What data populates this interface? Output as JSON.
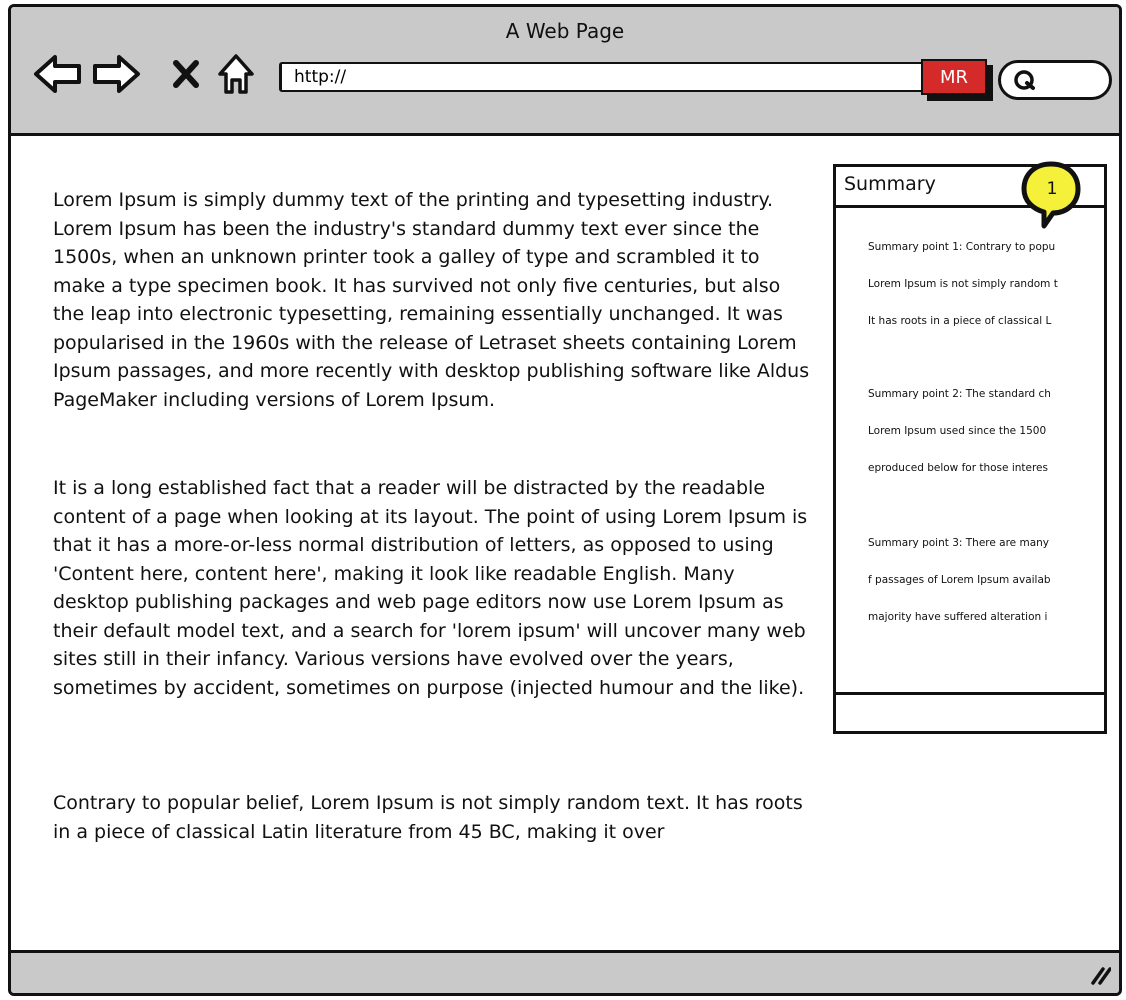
{
  "window": {
    "title": "A Web Page"
  },
  "toolbar": {
    "back_icon": "back-arrow-icon",
    "forward_icon": "forward-arrow-icon",
    "stop_icon": "close-x-icon",
    "home_icon": "home-icon",
    "address_value": "http://",
    "mr_label": "MR",
    "search_icon": "search-icon",
    "mr_color": "#d42a2a",
    "chrome_color": "#c9c9c9"
  },
  "article": {
    "paragraph1": "Lorem Ipsum is simply dummy text of the printing and typesetting industry. Lorem Ipsum has been the industry's standard dummy text ever since the 1500s, when an unknown printer took a galley of type and scrambled it to make a type specimen book. It has survived not only five centuries, but also the leap into electronic typesetting, remaining essentially unchanged. It was popularised in the 1960s with the release of Letraset sheets containing Lorem Ipsum passages, and more recently with desktop publishing software like Aldus PageMaker including versions of Lorem Ipsum.",
    "paragraph2": "It is a long established fact that a reader will be distracted by the readable content of a page when looking at its layout. The point of using Lorem Ipsum is that it has a more-or-less normal distribution of letters, as opposed to using 'Content here, content here', making it look like readable English. Many desktop publishing packages and web page editors now use Lorem Ipsum as their default model text, and a search for 'lorem ipsum' will uncover many web sites still in their infancy. Various versions have evolved over the years, sometimes by accident, sometimes on purpose (injected humour and the like).",
    "paragraph3": "Contrary to popular belief, Lorem Ipsum is not simply random text. It has roots in a piece of classical Latin literature from 45 BC, making it over"
  },
  "summary": {
    "title": "Summary",
    "badge": "1",
    "badge_color": "#f5f03a",
    "lines": [
      "Summary point 1: Contrary to popu",
      "Lorem Ipsum is not simply random t",
      "It has roots in a piece of classical L",
      "Summary point 2: The standard ch",
      "Lorem Ipsum used since the 1500",
      "eproduced below for those interes",
      "Summary point 3: There are many",
      "f passages of Lorem Ipsum availab",
      "majority have suffered alteration i"
    ]
  },
  "statusbar": {
    "resize_icon": "resize-grip-icon"
  }
}
